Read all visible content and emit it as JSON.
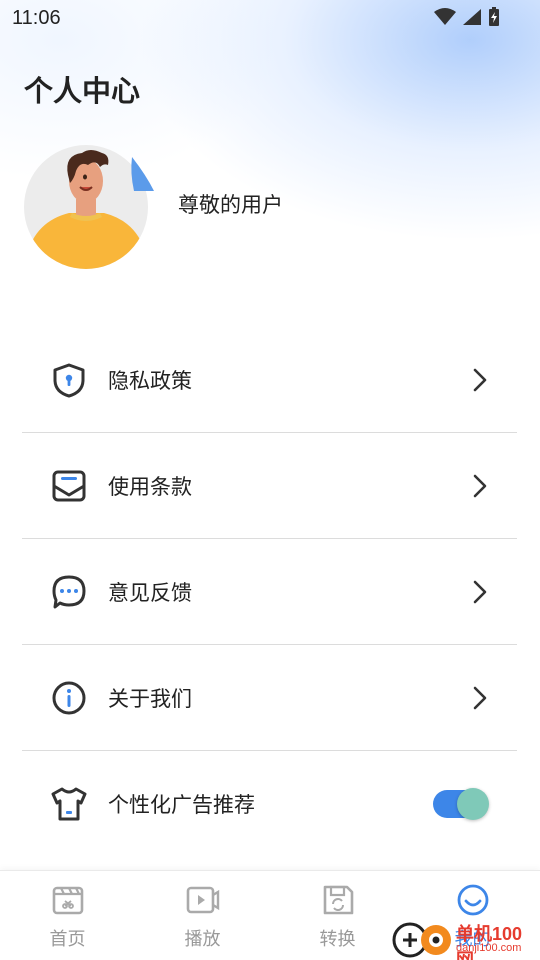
{
  "status_bar": {
    "time": "11:06"
  },
  "header": {
    "title": "个人中心"
  },
  "profile": {
    "username": "尊敬的用户"
  },
  "menu": {
    "items": [
      {
        "label": "隐私政策",
        "icon": "shield-icon"
      },
      {
        "label": "使用条款",
        "icon": "envelope-icon"
      },
      {
        "label": "意见反馈",
        "icon": "chat-bubble-icon"
      },
      {
        "label": "关于我们",
        "icon": "info-icon"
      },
      {
        "label": "个性化广告推荐",
        "icon": "tshirt-icon",
        "toggle_on": true
      }
    ]
  },
  "tabbar": {
    "tabs": [
      {
        "label": "首页",
        "icon": "clapperboard-icon",
        "active": false
      },
      {
        "label": "播放",
        "icon": "video-play-icon",
        "active": false
      },
      {
        "label": "转换",
        "icon": "save-convert-icon",
        "active": false
      },
      {
        "label": "我的",
        "icon": "smile-icon",
        "active": true
      }
    ]
  },
  "watermark": {
    "text": "单机100网",
    "sub": "danji100.com"
  },
  "colors": {
    "accent": "#3d86e8",
    "toggle_knob": "#7fc9b8",
    "avatar_shirt": "#f7b733"
  }
}
